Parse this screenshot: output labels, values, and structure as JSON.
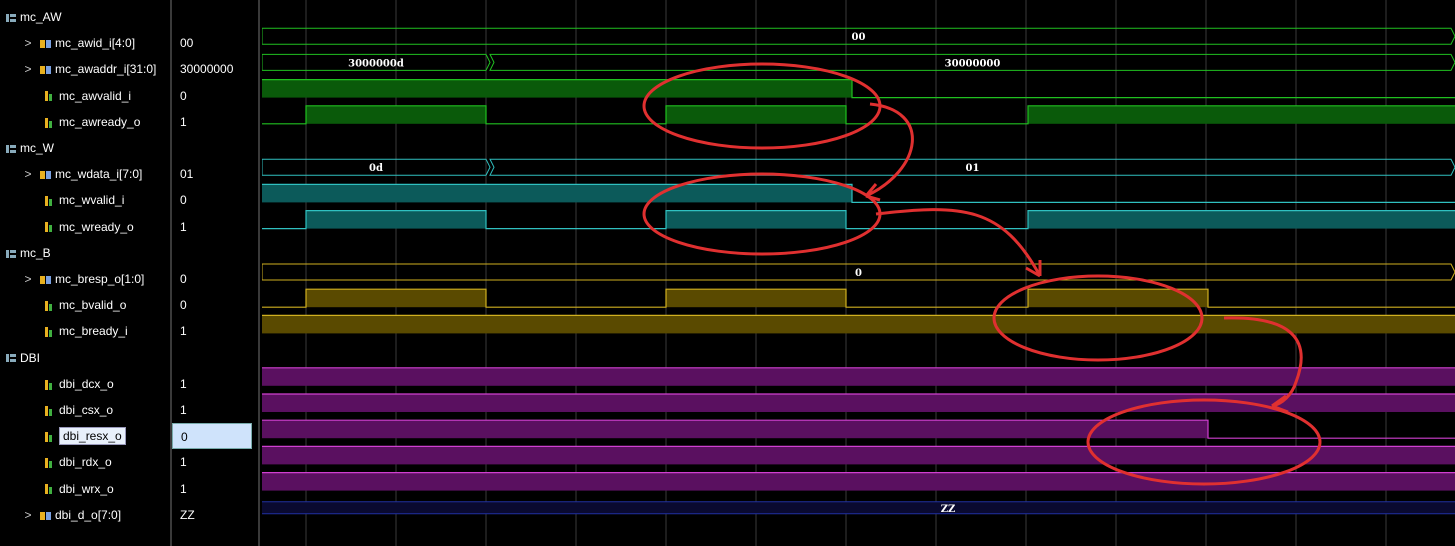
{
  "groups": [
    "mc_AW",
    "mc_W",
    "mc_B",
    "DBI"
  ],
  "rows": [
    {
      "kind": "group",
      "name": "mc_AW",
      "value": ""
    },
    {
      "kind": "bus",
      "name": "mc_awid_i[4:0]",
      "value": "00"
    },
    {
      "kind": "bus",
      "name": "mc_awaddr_i[31:0]",
      "value": "30000000"
    },
    {
      "kind": "bit",
      "name": "mc_awvalid_i",
      "value": "0"
    },
    {
      "kind": "bit",
      "name": "mc_awready_o",
      "value": "1"
    },
    {
      "kind": "group",
      "name": "mc_W",
      "value": ""
    },
    {
      "kind": "bus",
      "name": "mc_wdata_i[7:0]",
      "value": "01"
    },
    {
      "kind": "bit",
      "name": "mc_wvalid_i",
      "value": "0"
    },
    {
      "kind": "bit",
      "name": "mc_wready_o",
      "value": "1"
    },
    {
      "kind": "group",
      "name": "mc_B",
      "value": ""
    },
    {
      "kind": "bus",
      "name": "mc_bresp_o[1:0]",
      "value": "0"
    },
    {
      "kind": "bit",
      "name": "mc_bvalid_o",
      "value": "0"
    },
    {
      "kind": "bit",
      "name": "mc_bready_i",
      "value": "1"
    },
    {
      "kind": "group",
      "name": "DBI",
      "value": ""
    },
    {
      "kind": "bit",
      "name": "dbi_dcx_o",
      "value": "1"
    },
    {
      "kind": "bit",
      "name": "dbi_csx_o",
      "value": "1"
    },
    {
      "kind": "bit",
      "name": "dbi_resx_o",
      "value": "0",
      "selected": true
    },
    {
      "kind": "bit",
      "name": "dbi_rdx_o",
      "value": "1"
    },
    {
      "kind": "bit",
      "name": "dbi_wrx_o",
      "value": "1"
    },
    {
      "kind": "bus",
      "name": "dbi_d_o[7:0]",
      "value": "ZZ"
    }
  ],
  "bus_labels": {
    "awid": "00",
    "awaddr_a": "3000000d",
    "awaddr_b": "30000000",
    "wdata_a": "0d",
    "wdata_b": "01",
    "bresp": "0",
    "dbi_d": "ZZ"
  },
  "colors": {
    "green": "#20c020",
    "green_fill": "#0a5a0a",
    "cyan": "#30c0c0",
    "cyan_fill": "#0c5a5a",
    "yellow": "#d0b020",
    "yellow_fill": "#5a4a00",
    "magenta": "#d040d0",
    "magenta_fill": "#5a1060",
    "grid": "#3a3a3a",
    "annotation": "#e03030",
    "dbi_bus": "#2030a0"
  },
  "icons": {
    "group": "group-icon",
    "bus": "bus-icon",
    "bit": "bit-icon",
    "expand": "chevron-right-icon"
  }
}
